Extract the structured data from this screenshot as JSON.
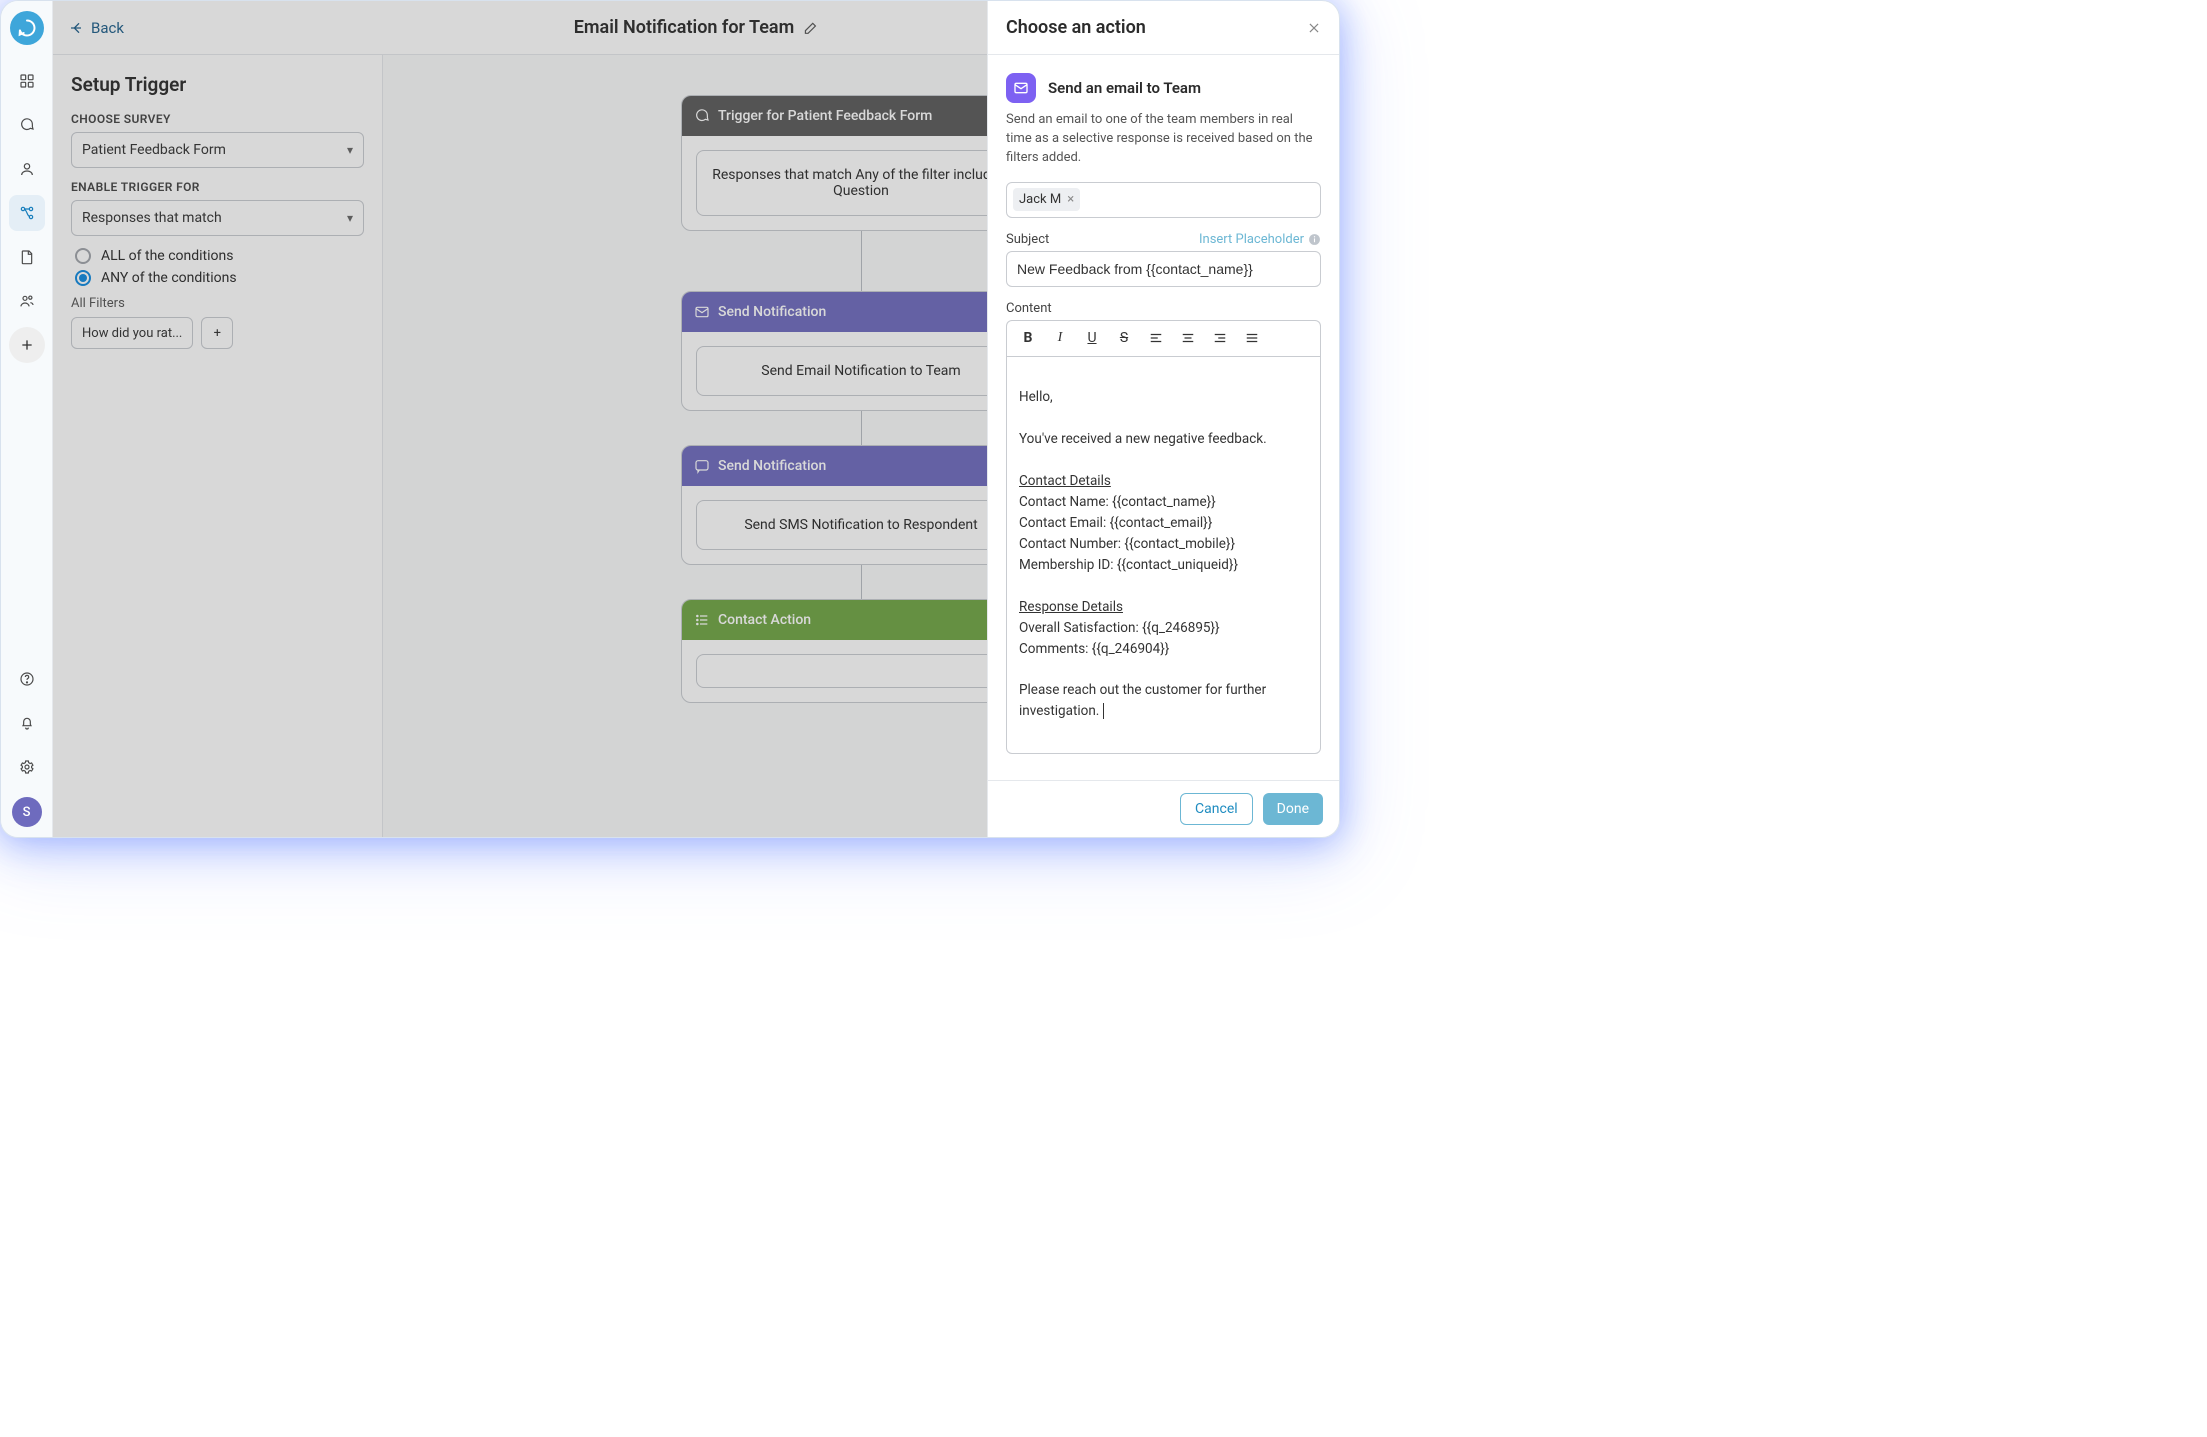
{
  "header": {
    "back_label": "Back",
    "title": "Email Notification for Team"
  },
  "rail": {
    "avatar_initial": "S"
  },
  "sidebar": {
    "title": "Setup Trigger",
    "choose_survey_label": "CHOOSE SURVEY",
    "survey_value": "Patient Feedback Form",
    "enable_label": "ENABLE TRIGGER FOR",
    "enable_value": "Responses that match",
    "radio_all": "ALL of the conditions",
    "radio_any": "ANY of the conditions",
    "filters_label": "All Filters",
    "filter_chip": "How did you rat...",
    "add_chip": "+"
  },
  "flow": {
    "trigger": {
      "head": "Trigger for Patient Feedback Form",
      "body": "Responses that match Any of the filter including Question"
    },
    "node1": {
      "head": "Send Notification",
      "body": "Send Email Notification to Team"
    },
    "node2": {
      "head": "Send Notification",
      "body": "Send SMS Notification to Respondent"
    },
    "node3": {
      "head": "Contact Action"
    }
  },
  "drawer": {
    "title": "Choose an action",
    "action_title": "Send an email to Team",
    "action_desc": "Send an email to one of the team members in real time as a selective response is received based on the filters added.",
    "recipient_tag": "Jack M",
    "subject_label": "Subject",
    "insert_placeholder": "Insert Placeholder",
    "subject_value": "New Feedback from {{contact_name}}",
    "content_label": "Content",
    "editor": {
      "p1": "Hello,",
      "p2": "You've received a new negative feedback.",
      "h1": "Contact Details",
      "l1": "Contact Name: {{contact_name}}",
      "l2": "Contact Email: {{contact_email}}",
      "l3": "Contact Number: {{contact_mobile}}",
      "l4": "Membership ID: {{contact_uniqueid}}",
      "h2": "Response Details",
      "l5": "Overall Satisfaction: {{q_246895}}",
      "l6": "Comments: {{q_246904}}",
      "p3": "Please reach out the customer for further investigation."
    },
    "cancel": "Cancel",
    "done": "Done"
  }
}
